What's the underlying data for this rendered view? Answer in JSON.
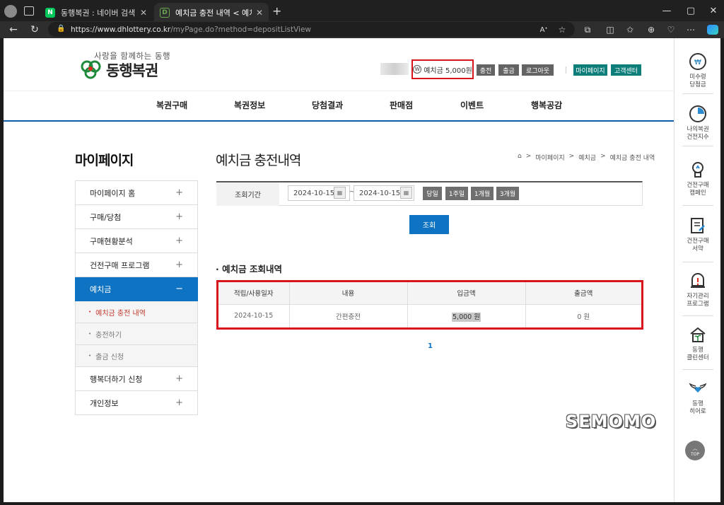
{
  "browser": {
    "tabs": [
      {
        "title": "동행복권 : 네이버 검색",
        "favicon": "N"
      },
      {
        "title": "예치금 충전 내역 < 예치금 < 마이",
        "favicon": "D"
      }
    ],
    "new_tab": "+",
    "url_host": "https://www.dhlottery.co.kr",
    "url_path": "/myPage.do?method=depositListView"
  },
  "header": {
    "tagline": "사랑을 함께하는 동행",
    "logo_text": "동행복권",
    "deposit_label": "예치금",
    "deposit_amount": "5,000원",
    "won_symbol": "W",
    "buttons": [
      "충전",
      "출금",
      "로그아웃"
    ],
    "right_buttons": [
      "마이페이지",
      "고객센터"
    ]
  },
  "gnb": [
    "복권구매",
    "복권정보",
    "당첨결과",
    "판매점",
    "이벤트",
    "행복공감"
  ],
  "sidebar": {
    "title": "마이페이지",
    "items": [
      {
        "label": "마이페이지 홈",
        "icon": "+"
      },
      {
        "label": "구매/당첨",
        "icon": "+"
      },
      {
        "label": "구매현황분석",
        "icon": "+"
      },
      {
        "label": "건전구매 프로그램",
        "icon": "+"
      },
      {
        "label": "예치금",
        "icon": "−"
      }
    ],
    "subitems": [
      "예치금 충전 내역",
      "충전하기",
      "출금 신청"
    ],
    "items_after": [
      {
        "label": "행복더하기 신청",
        "icon": "+"
      },
      {
        "label": "개인정보",
        "icon": "+"
      }
    ]
  },
  "content": {
    "title": "예치금 충전내역",
    "breadcrumb": [
      "마이페이지",
      "예치금",
      "예치금 충전 내역"
    ],
    "period_label": "조회기간",
    "date_from": "2024-10-15",
    "date_to": "2024-10-15",
    "tilde": "~",
    "period_buttons": [
      "당일",
      "1주일",
      "1개월",
      "3개월"
    ],
    "search_button": "조회",
    "section_title": "· 예치금 조회내역",
    "table": {
      "headers": [
        "적립/사용일자",
        "내용",
        "입금액",
        "출금액"
      ],
      "rows": [
        [
          "2024-10-15",
          "간편충전",
          "5,000 원",
          "0 원"
        ]
      ]
    },
    "page": "1"
  },
  "quickbar": [
    {
      "label": "미수령\n당첨금",
      "icon": "won-coin-icon"
    },
    {
      "label": "나의복권\n건전지수",
      "icon": "gauge-icon"
    },
    {
      "label": "건전구매\n캠페인",
      "icon": "lightbulb-icon"
    },
    {
      "label": "건전구매\n서약",
      "icon": "pledge-document-icon"
    },
    {
      "label": "자기관리\n프로그램",
      "icon": "alert-icon"
    },
    {
      "label": "동행\n클린센터",
      "icon": "house-plant-icon"
    },
    {
      "label": "동행\n히어로",
      "icon": "wings-heart-icon"
    }
  ],
  "top_button": "TOP",
  "watermark": "SEMOMO",
  "colors": {
    "primary": "#0e73c2",
    "teal": "#0e7e7a",
    "highlight": "#d8141d"
  }
}
